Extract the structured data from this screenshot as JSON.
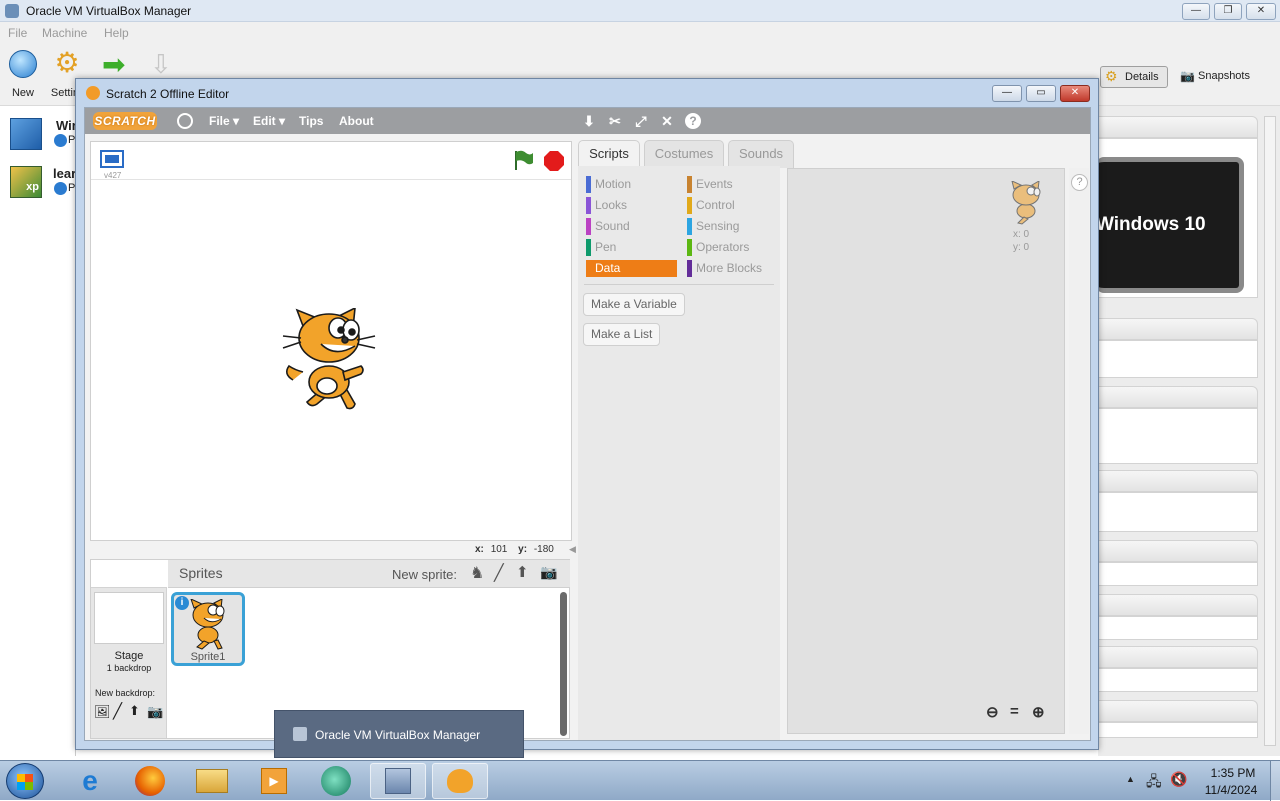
{
  "vbox": {
    "title": "Oracle VM VirtualBox Manager",
    "menu": [
      "File",
      "Machine",
      "Help"
    ],
    "toolbar": {
      "new": "New",
      "settings": "Settin"
    },
    "vm_list": [
      {
        "name": "Wir",
        "state": "P"
      },
      {
        "name": "lear",
        "state": "P"
      }
    ],
    "details_button": "Details",
    "snapshots_button": "Snapshots",
    "preview_text": "Windows 10"
  },
  "scratch": {
    "window_title": "Scratch 2 Offline Editor",
    "logo": "SCRATCH",
    "menu": {
      "file": "File ▾",
      "edit": "Edit ▾",
      "tips": "Tips",
      "about": "About"
    },
    "version": "v427",
    "coords": {
      "x_label": "x:",
      "x": "101",
      "y_label": "y:",
      "y": "-180"
    },
    "tabs": {
      "scripts": "Scripts",
      "costumes": "Costumes",
      "sounds": "Sounds"
    },
    "categories_left": [
      {
        "label": "Motion",
        "color": "#4a6cd4"
      },
      {
        "label": "Looks",
        "color": "#8a55d7"
      },
      {
        "label": "Sound",
        "color": "#bb42c3"
      },
      {
        "label": "Pen",
        "color": "#0e9a6c"
      },
      {
        "label": "Data",
        "color": "#ee7d16"
      }
    ],
    "categories_right": [
      {
        "label": "Events",
        "color": "#c88330"
      },
      {
        "label": "Control",
        "color": "#e1a91a"
      },
      {
        "label": "Sensing",
        "color": "#2ca5e2"
      },
      {
        "label": "Operators",
        "color": "#5cb712"
      },
      {
        "label": "More Blocks",
        "color": "#632d99"
      }
    ],
    "selected_category": "Data",
    "make_variable": "Make a Variable",
    "make_list": "Make a List",
    "script_coords": {
      "x": "x: 0",
      "y": "y: 0"
    },
    "sprites_header": "Sprites",
    "new_sprite": "New sprite:",
    "stage_label": "Stage",
    "backdrop_count": "1 backdrop",
    "new_backdrop": "New backdrop:",
    "sprite1": "Sprite1"
  },
  "popup": {
    "title": "Oracle VM VirtualBox Manager"
  },
  "taskbar": {
    "time": "1:35 PM",
    "date": "11/4/2024"
  }
}
